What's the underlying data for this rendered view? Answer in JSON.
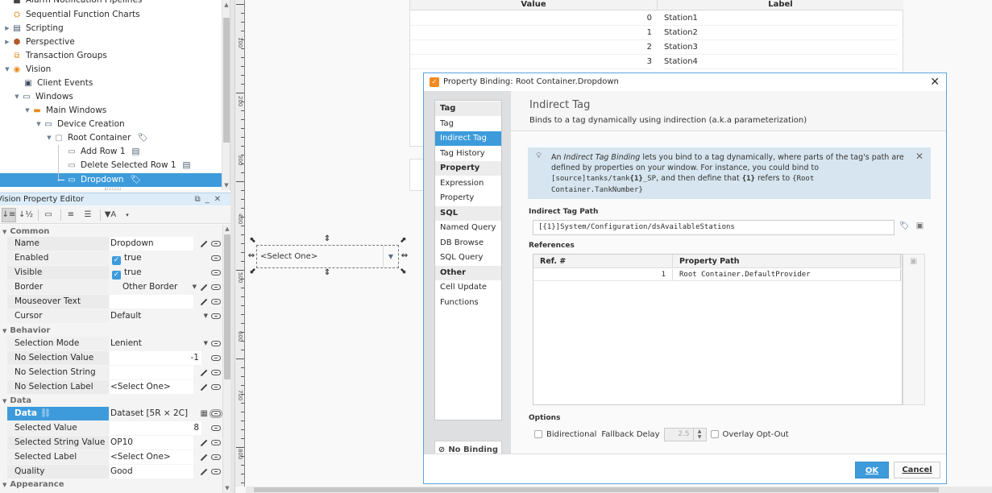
{
  "project_tree": {
    "items": [
      {
        "label": "Alarm Notification Pipelines",
        "icon": "pipeline-icon",
        "expander": "none"
      },
      {
        "label": "Sequential Function Charts",
        "icon": "sfc-icon",
        "expander": "none"
      },
      {
        "label": "Scripting",
        "icon": "scripting-icon",
        "expander": "collapsed"
      },
      {
        "label": "Perspective",
        "icon": "perspective-icon",
        "expander": "collapsed"
      },
      {
        "label": "Transaction Groups",
        "icon": "transaction-groups-icon",
        "expander": "none"
      },
      {
        "label": "Vision",
        "icon": "vision-icon",
        "expander": "expanded"
      },
      {
        "label": "Client Events",
        "icon": "client-events-icon",
        "expander": "none"
      },
      {
        "label": "Windows",
        "icon": "windows-icon",
        "expander": "expanded"
      },
      {
        "label": "Main Windows",
        "icon": "folder-icon",
        "expander": "expanded"
      },
      {
        "label": "Device Creation",
        "icon": "window-icon",
        "expander": "expanded"
      },
      {
        "label": "Root Container",
        "icon": "container-icon",
        "expander": "expanded",
        "badge": "tag-icon"
      },
      {
        "label": "Add Row 1",
        "icon": "button-component-icon",
        "expander": "none",
        "badge": "script-icon"
      },
      {
        "label": "Delete Selected Row 1",
        "icon": "button-component-icon",
        "expander": "none",
        "badge": "script-icon"
      },
      {
        "label": "Dropdown",
        "icon": "dropdown-component-icon",
        "expander": "none",
        "badge": "tag-icon",
        "selected": true
      }
    ]
  },
  "property_editor": {
    "title": "Vision Property Editor",
    "categories": [
      {
        "name": "Common",
        "rows": [
          {
            "name": "Name",
            "value": "Dropdown",
            "actions": [
              "pencil",
              "link"
            ]
          },
          {
            "name": "Enabled",
            "value": "true",
            "checkbox": true,
            "actions": [
              "link"
            ]
          },
          {
            "name": "Visible",
            "value": "true",
            "checkbox": true,
            "actions": [
              "link"
            ]
          },
          {
            "name": "Border",
            "value": "Other Border",
            "actions": [
              "dropdown",
              "pencil",
              "link"
            ]
          },
          {
            "name": "Mouseover Text",
            "value": "",
            "actions": [
              "pencil",
              "link"
            ]
          },
          {
            "name": "Cursor",
            "value": "Default",
            "actions": [
              "dropdown",
              "link"
            ]
          }
        ]
      },
      {
        "name": "Behavior",
        "rows": [
          {
            "name": "Selection Mode",
            "value": "Lenient",
            "actions": [
              "dropdown",
              "link"
            ]
          },
          {
            "name": "No Selection Value",
            "value": "-1",
            "actions": [
              "link"
            ]
          },
          {
            "name": "No Selection String",
            "value": "",
            "actions": [
              "pencil",
              "link"
            ]
          },
          {
            "name": "No Selection Label",
            "value": "<Select One>",
            "actions": [
              "pencil",
              "link"
            ]
          }
        ]
      },
      {
        "name": "Data",
        "rows": [
          {
            "name": "Data",
            "value": "Dataset [5R × 2C]",
            "actions": [
              "dataset-viewer",
              "link"
            ],
            "selected": true
          },
          {
            "name": "Selected Value",
            "value": "8",
            "actions": [
              "link"
            ]
          },
          {
            "name": "Selected String Value",
            "value": "OP10",
            "actions": [
              "pencil",
              "link"
            ]
          },
          {
            "name": "Selected Label",
            "value": "<Select One>",
            "actions": [
              "pencil",
              "link"
            ]
          },
          {
            "name": "Quality",
            "value": "Good",
            "actions": [
              "pencil",
              "link"
            ]
          }
        ]
      },
      {
        "name": "Appearance",
        "rows": []
      }
    ]
  },
  "canvas": {
    "ruler_labels": [
      "100",
      "200",
      "300",
      "400",
      "500",
      "600",
      "700",
      "800"
    ],
    "dataset_table": {
      "columns": [
        "Value",
        "Label"
      ],
      "rows": [
        {
          "value": "0",
          "label": "Station1"
        },
        {
          "value": "1",
          "label": "Station2"
        },
        {
          "value": "2",
          "label": "Station3"
        },
        {
          "value": "3",
          "label": "Station4"
        }
      ]
    },
    "dropdown_component": {
      "text": "<Select One>"
    }
  },
  "dialog": {
    "title": "Property Binding: Root Container.Dropdown",
    "binding_types": [
      {
        "label": "Tag",
        "header": true
      },
      {
        "label": "Tag"
      },
      {
        "label": "Indirect Tag",
        "selected": true
      },
      {
        "label": "Tag History"
      },
      {
        "label": "Property",
        "header": true
      },
      {
        "label": "Expression"
      },
      {
        "label": "Property"
      },
      {
        "label": "SQL",
        "header": true
      },
      {
        "label": "Named Query"
      },
      {
        "label": "DB Browse"
      },
      {
        "label": "SQL Query"
      },
      {
        "label": "Other",
        "header": true
      },
      {
        "label": "Cell Update"
      },
      {
        "label": "Functions"
      }
    ],
    "no_binding_label": "No Binding",
    "heading": "Indirect Tag",
    "subheading": "Binds to a tag dynamically using indirection (a.k.a parameterization)",
    "info": {
      "part1": "An ",
      "italic": "Indirect Tag Binding",
      "part2": " lets you bind to a tag dynamically, where parts of the tag's path are defined by properties on your window. For instance, you could bind to ",
      "code1": "[source]tanks/tank",
      "code1b": "{1}",
      "code1c": "_SP",
      "part3": ", and then define that ",
      "code2": "{1}",
      "part4": " refers to ",
      "code3": "{Root Container.TankNumber}"
    },
    "tag_path_label": "Indirect Tag Path",
    "tag_path_value": "[{1}]System/Configuration/dsAvailableStations",
    "references_label": "References",
    "references_columns": [
      "Ref. #",
      "Property Path"
    ],
    "references_rows": [
      {
        "ref": "1",
        "path": "Root Container.DefaultProvider"
      }
    ],
    "options_label": "Options",
    "options": {
      "bidirectional_label": "Bidirectional",
      "bidirectional_checked": false,
      "fallback_delay_label": "Fallback Delay",
      "fallback_delay_value": "2.5",
      "overlay_opt_out_label": "Overlay Opt-Out",
      "overlay_opt_out_checked": false
    },
    "ok_label": "OK",
    "cancel_label": "Cancel"
  }
}
